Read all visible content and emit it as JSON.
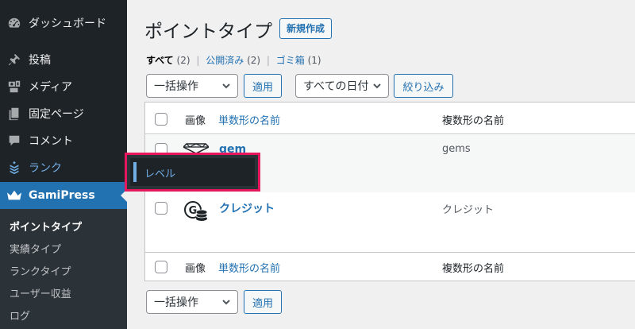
{
  "sidebar": {
    "items": [
      {
        "label": "ダッシュボード",
        "icon": "dashboard-icon"
      },
      {
        "label": "投稿",
        "icon": "pin-icon"
      },
      {
        "label": "メディア",
        "icon": "media-icon"
      },
      {
        "label": "固定ページ",
        "icon": "page-icon"
      },
      {
        "label": "コメント",
        "icon": "comment-icon"
      },
      {
        "label": "ランク",
        "icon": "rank-icon"
      },
      {
        "label": "GamiPress",
        "icon": "crown-icon"
      }
    ],
    "submenu": [
      "ポイントタイプ",
      "実績タイプ",
      "ランクタイプ",
      "ユーザー収益",
      "ログ"
    ],
    "flyout": "レベル"
  },
  "header": {
    "title": "ポイントタイプ",
    "add_new": "新規作成"
  },
  "filters": {
    "all": "すべて",
    "all_count": "(2)",
    "published": "公開済み",
    "published_count": "(2)",
    "trash": "ゴミ箱",
    "trash_count": "(1)",
    "separator": "|"
  },
  "toolbar": {
    "bulk_action": "一括操作",
    "apply": "適用",
    "all_dates": "すべての日付",
    "filter": "絞り込み"
  },
  "table": {
    "columns": {
      "image": "画像",
      "singular": "単数形の名前",
      "plural": "複数形の名前"
    },
    "rows": [
      {
        "singular": "gem",
        "plural": "gems",
        "icon": "gem-icon"
      },
      {
        "singular": "クレジット",
        "plural": "クレジット",
        "icon": "credit-coin-icon"
      }
    ]
  },
  "colors": {
    "accent": "#2271b1",
    "sidebar": "#1d2327",
    "highlight": "#e6175d"
  }
}
